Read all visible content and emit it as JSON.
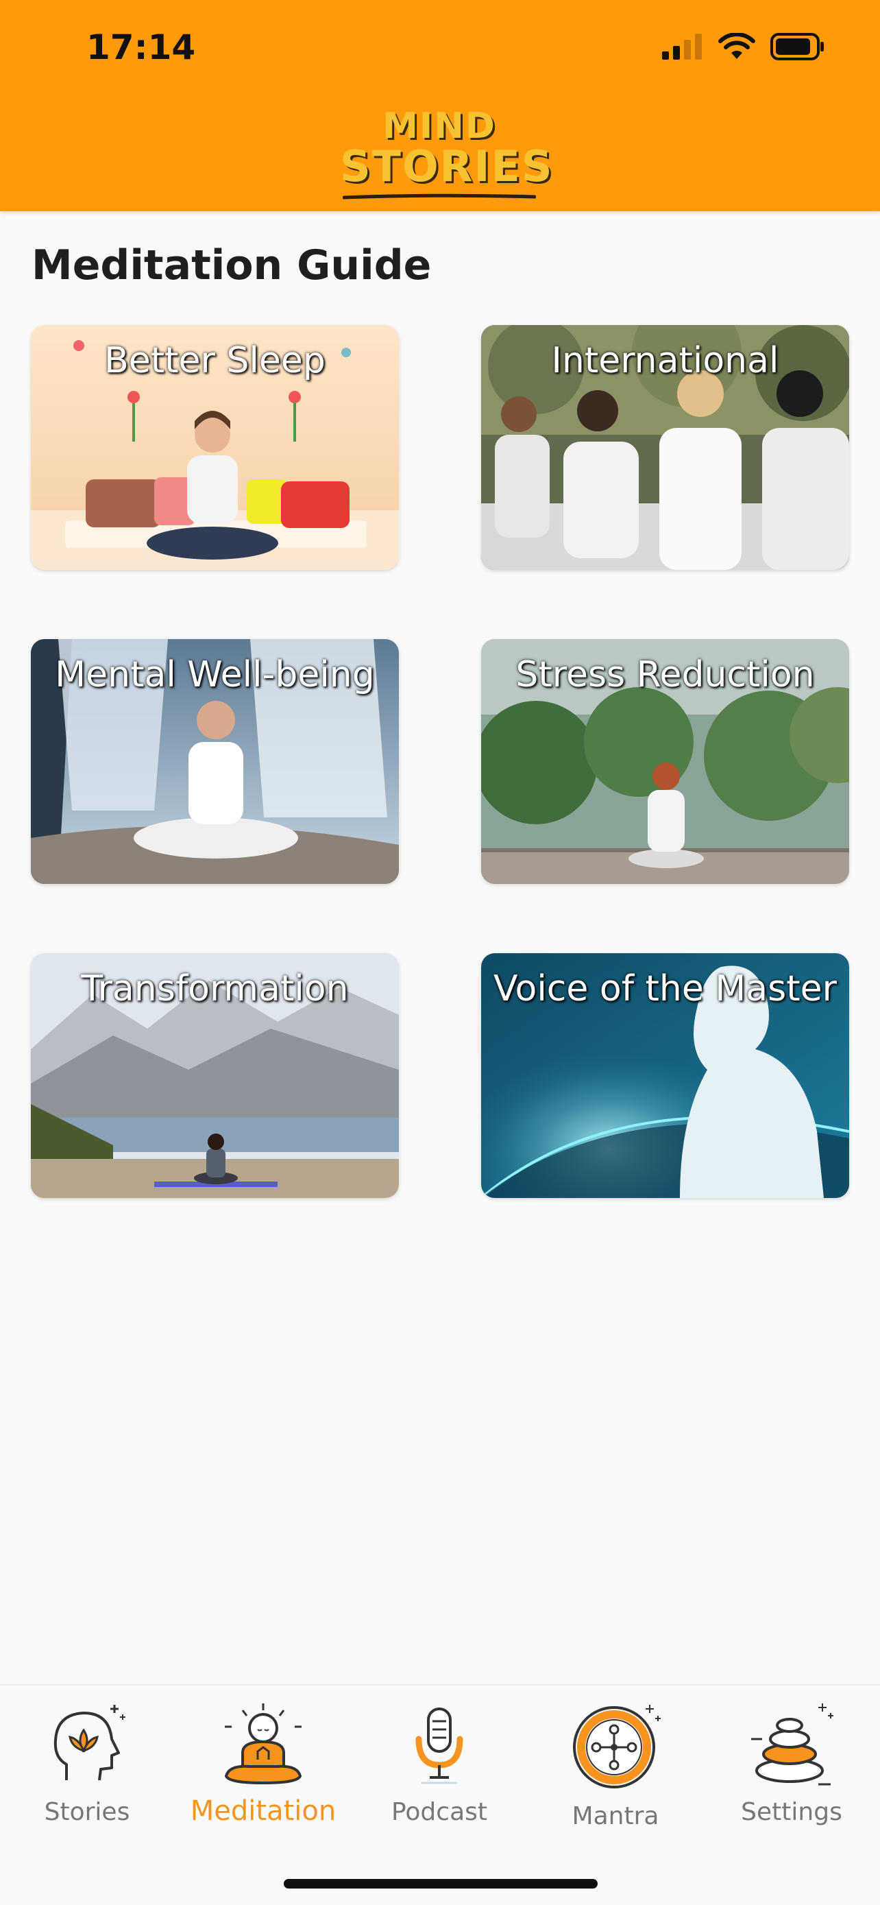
{
  "status_bar": {
    "time": "17:14"
  },
  "header": {
    "logo_line1": "MIND",
    "logo_line2": "STORIES",
    "brand_color": "#ff9a0a"
  },
  "page": {
    "title": "Meditation Guide"
  },
  "cards": [
    {
      "title": "Better Sleep"
    },
    {
      "title": "International"
    },
    {
      "title": "Mental Well-being"
    },
    {
      "title": "Stress Reduction"
    },
    {
      "title": "Transformation"
    },
    {
      "title": "Voice of the Master"
    }
  ],
  "tabs": [
    {
      "label": "Stories",
      "icon": "head-lotus-icon",
      "active": false
    },
    {
      "label": "Meditation",
      "icon": "meditating-person-icon",
      "active": true
    },
    {
      "label": "Podcast",
      "icon": "microphone-icon",
      "active": false
    },
    {
      "label": "Mantra",
      "icon": "mantra-wheel-icon",
      "active": false
    },
    {
      "label": "Settings",
      "icon": "stacked-stones-icon",
      "active": false
    }
  ],
  "colors": {
    "accent": "#f7941d",
    "inactive": "#777777"
  }
}
